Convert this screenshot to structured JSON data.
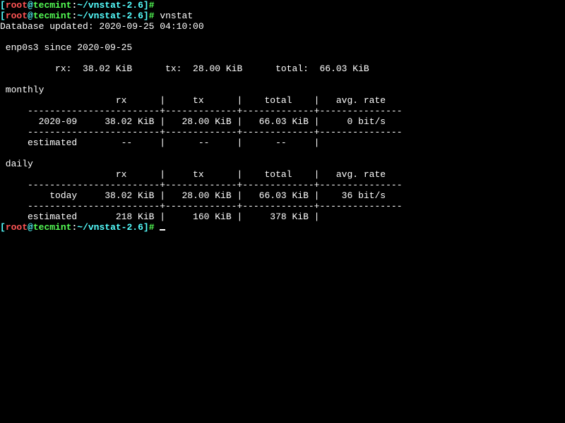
{
  "prompt": {
    "open": "[",
    "user": "root",
    "at": "@",
    "host": "tecmint",
    "colon": ":",
    "path": "~/vnstat-2.6",
    "close": "]",
    "hash": "#"
  },
  "cmd": "vnstat",
  "db_updated_line": "Database updated: 2020-09-25 04:10:00",
  "iface_line": " enp0s3 since 2020-09-25",
  "summary_line": "          rx:  38.02 KiB      tx:  28.00 KiB      total:  66.03 KiB",
  "monthly_header": " monthly",
  "daily_header": " daily",
  "col_header": "                     rx      |     tx      |    total    |   avg. rate",
  "divider_top": "     ------------------------+-------------+-------------+---------------",
  "divider_mid": "     ------------------------+-------------+-------------+---------------",
  "monthly_row": "       2020-09     38.02 KiB |   28.00 KiB |   66.03 KiB |     0 bit/s",
  "monthly_est": "     estimated        --     |      --     |      --     |",
  "daily_row": "         today     38.02 KiB |   28.00 KiB |   66.03 KiB |    36 bit/s",
  "daily_est": "     estimated       218 KiB |     160 KiB |     378 KiB |",
  "blank": ""
}
